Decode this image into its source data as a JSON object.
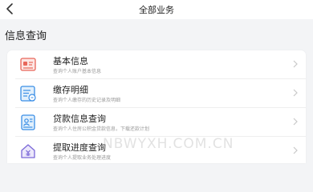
{
  "header": {
    "title": "全部业务",
    "back_icon": "chevron-left-icon"
  },
  "section": {
    "title": "信息查询"
  },
  "items": [
    {
      "title": "基本信息",
      "desc": "查询个人账户基本信息",
      "icon": "id-card-icon"
    },
    {
      "title": "缴存明细",
      "desc": "查询个人缴存的历史记录及明细",
      "icon": "document-list-icon"
    },
    {
      "title": "贷款信息查询",
      "desc": "查询个人住房公积金贷款信息，下载还款计划",
      "icon": "loan-document-icon"
    },
    {
      "title": "提取进度查询",
      "desc": "查询个人提取业务处理进度",
      "icon": "house-yen-icon"
    }
  ],
  "watermark": "NBWYXH.COM.CN",
  "colors": {
    "icon_red": "#e8665a",
    "icon_blue": "#3a8ee6",
    "icon_purple": "#7b68d8",
    "arrow": "#c8c8c8"
  }
}
